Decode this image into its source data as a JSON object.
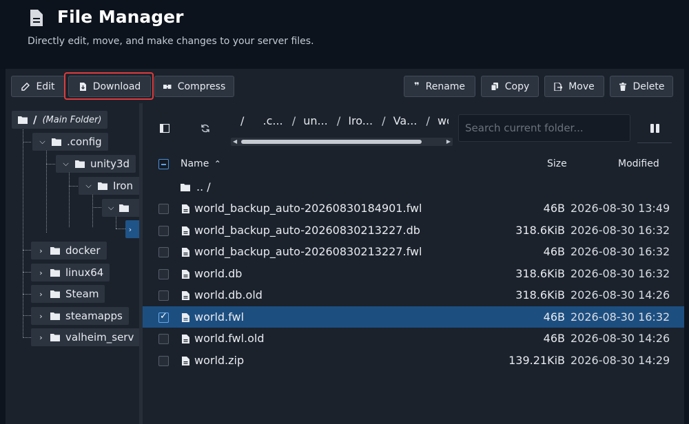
{
  "header": {
    "title": "File Manager",
    "subtitle": "Directly edit, move, and make changes to your server files."
  },
  "toolbar": {
    "edit": "Edit",
    "download": "Download",
    "compress": "Compress",
    "rename": "Rename",
    "copy": "Copy",
    "move": "Move",
    "delete": "Delete"
  },
  "tree": {
    "root": "/",
    "root_label": "(Main Folder)",
    "items": [
      {
        "label": ".config"
      },
      {
        "label": "unity3d"
      },
      {
        "label": "Iron"
      },
      {
        "label": ""
      },
      {
        "label": ""
      },
      {
        "label": "docker"
      },
      {
        "label": "linux64"
      },
      {
        "label": "Steam"
      },
      {
        "label": "steamapps"
      },
      {
        "label": "valheim_serv"
      }
    ]
  },
  "breadcrumb": [
    "/",
    ".c...",
    "un...",
    "Iro...",
    "Va...",
    "worlds_l"
  ],
  "search": {
    "placeholder": "Search current folder..."
  },
  "table": {
    "col_name": "Name",
    "col_size": "Size",
    "col_modified": "Modified",
    "parent": ".. /",
    "rows": [
      {
        "name": "world_backup_auto-20260830184901.fwl",
        "size": "46B",
        "modified": "2026-08-30 13:49"
      },
      {
        "name": "world_backup_auto-20260830213227.db",
        "size": "318.6KiB",
        "modified": "2026-08-30 16:32"
      },
      {
        "name": "world_backup_auto-20260830213227.fwl",
        "size": "46B",
        "modified": "2026-08-30 16:32"
      },
      {
        "name": "world.db",
        "size": "318.6KiB",
        "modified": "2026-08-30 16:32"
      },
      {
        "name": "world.db.old",
        "size": "318.6KiB",
        "modified": "2026-08-30 14:26"
      },
      {
        "name": "world.fwl",
        "size": "46B",
        "modified": "2026-08-30 16:32"
      },
      {
        "name": "world.fwl.old",
        "size": "46B",
        "modified": "2026-08-30 14:26"
      },
      {
        "name": "world.zip",
        "size": "139.21KiB",
        "modified": "2026-08-30 14:29"
      }
    ]
  },
  "colors": {
    "accent": "#1f5489",
    "highlight": "#e03c3c"
  }
}
